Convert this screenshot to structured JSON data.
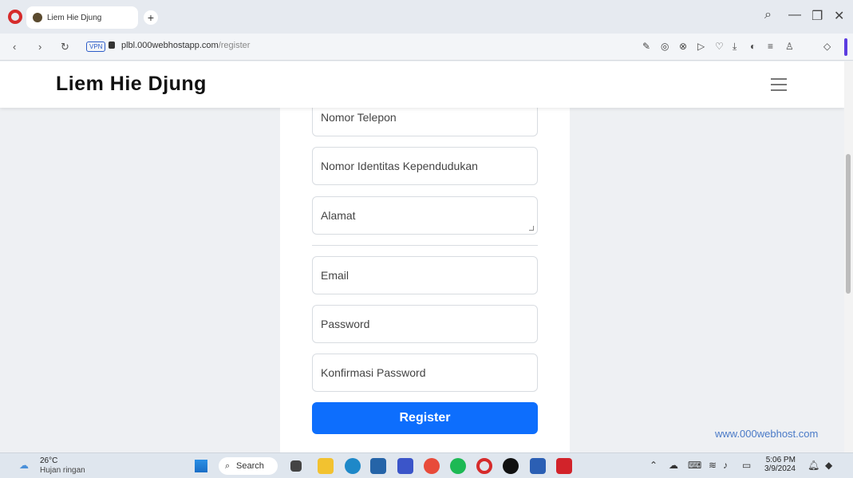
{
  "browser": {
    "tab_title": "Liem Hie Djung",
    "new_tab": "+",
    "vpn_badge": "VPN",
    "url_host": "plbl.000webhostapp.com",
    "url_path": "/register",
    "win_search": "⌕",
    "win_min": "—",
    "win_restore": "❐",
    "win_close": "✕",
    "back": "‹",
    "forward": "›",
    "reload": "↻"
  },
  "site": {
    "brand": "Liem Hie Djung"
  },
  "form": {
    "phone_placeholder": "Nomor Telepon",
    "nik_placeholder": "Nomor Identitas Kependudukan",
    "address_placeholder": "Alamat",
    "email_placeholder": "Email",
    "password_placeholder": "Password",
    "confirm_password_placeholder": "Konfirmasi Password",
    "register_label": "Register"
  },
  "footer": {
    "host_link": "www.000webhost.com"
  },
  "taskbar": {
    "temperature": "26°C",
    "condition": "Hujan ringan",
    "search_label": "Search",
    "time": "5:06 PM",
    "date": "3/9/2024"
  },
  "colors": {
    "accent": "#0d6efd",
    "opera_red": "#d62b2b"
  }
}
